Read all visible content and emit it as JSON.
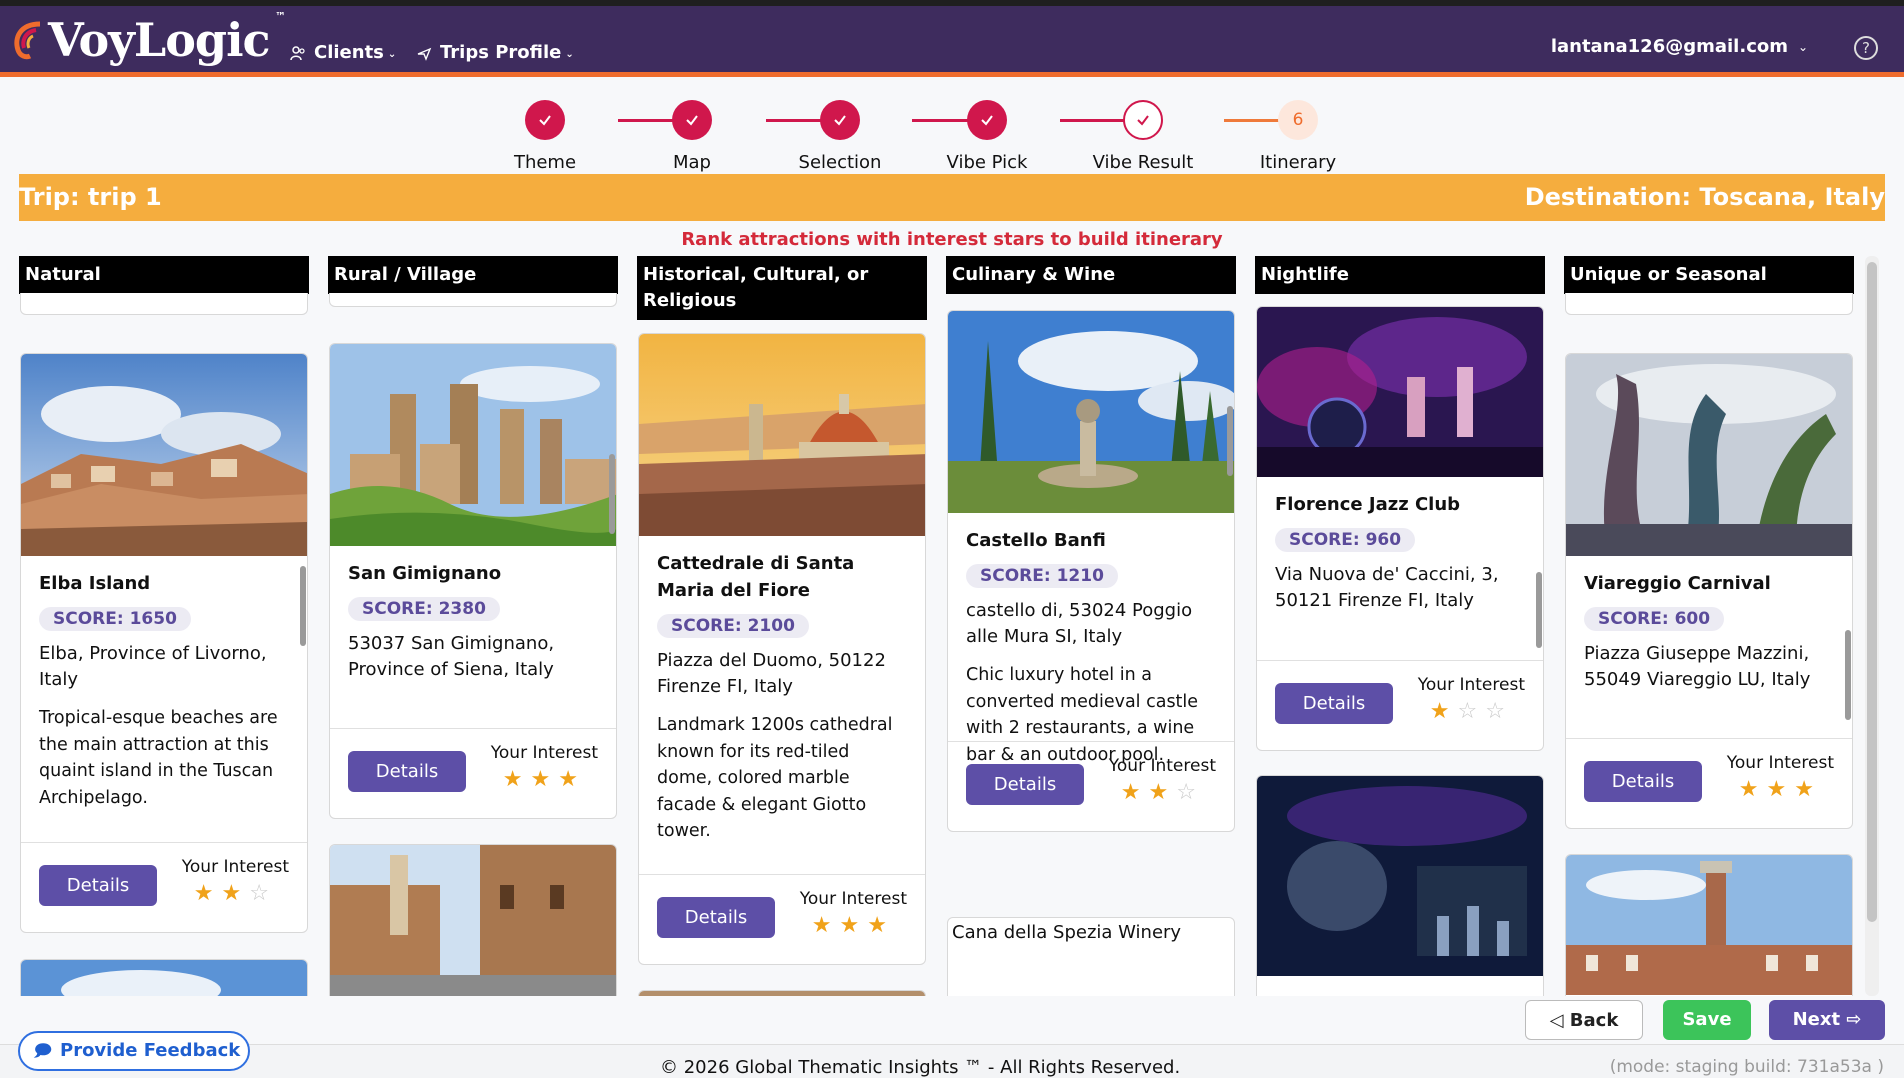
{
  "app": {
    "logo_text": "VoyLogic",
    "logo_tm": "™",
    "nav": [
      {
        "label": "Clients",
        "icon": "users-icon"
      },
      {
        "label": "Trips Profile",
        "icon": "plane-icon"
      }
    ],
    "user_email": "lantana126@gmail.com",
    "help_label": "?"
  },
  "stepper": {
    "steps": [
      {
        "label": "Theme",
        "state": "done"
      },
      {
        "label": "Map",
        "state": "done"
      },
      {
        "label": "Selection",
        "state": "done"
      },
      {
        "label": "Vibe Pick",
        "state": "done"
      },
      {
        "label": "Vibe Result",
        "state": "current"
      },
      {
        "label": "Itinerary",
        "state": "pending",
        "number": "6"
      }
    ]
  },
  "trip": {
    "trip_label": "Trip: trip 1",
    "destination_label": "Destination: Toscana, Italy"
  },
  "hint": "Rank attractions with interest stars to build itinerary",
  "labels": {
    "details": "Details",
    "your_interest": "Your Interest"
  },
  "columns": [
    {
      "title": "Natural",
      "cards": [
        {
          "title": "Elba Island",
          "score": "SCORE: 1650",
          "address": "Elba, Province of Livorno, Italy",
          "description": "Tropical-esque beaches are the main attraction at this quaint island in the Tuscan Archipelago.",
          "stars": 2
        }
      ]
    },
    {
      "title": "Rural / Village",
      "cards": [
        {
          "title": "San Gimignano",
          "score": "SCORE: 2380",
          "address": "53037 San Gimignano, Province of Siena, Italy",
          "description": "",
          "stars": 3
        }
      ]
    },
    {
      "title": "Historical, Cultural, or Religious",
      "cards": [
        {
          "title": "Cattedrale di Santa Maria del Fiore",
          "score": "SCORE: 2100",
          "address": "Piazza del Duomo, 50122 Firenze FI, Italy",
          "description": "Landmark 1200s cathedral known for its red-tiled dome, colored marble facade & elegant Giotto tower.",
          "stars": 3
        }
      ]
    },
    {
      "title": "Culinary & Wine",
      "cards": [
        {
          "title": "Castello Banfi",
          "score": "SCORE: 1210",
          "address": "castello di, 53024 Poggio alle Mura SI, Italy",
          "description": "Chic luxury hotel in a converted medieval castle with 2 restaurants, a wine bar & an outdoor pool.",
          "stars": 2
        }
      ],
      "next_card_title": "Cana della Spezia Winery"
    },
    {
      "title": "Nightlife",
      "cards": [
        {
          "title": "Florence Jazz Club",
          "score": "SCORE: 960",
          "address": "Via Nuova de' Caccini, 3, 50121 Firenze FI, Italy",
          "description": "",
          "stars": 1
        }
      ]
    },
    {
      "title": "Unique or Seasonal",
      "cards": [
        {
          "title": "Viareggio Carnival",
          "score": "SCORE: 600",
          "address": "Piazza Giuseppe Mazzini, 55049 Viareggio LU, Italy",
          "description": "",
          "stars": 3
        }
      ]
    }
  ],
  "actions": {
    "back": "Back",
    "save": "Save",
    "next": "Next"
  },
  "feedback": "Provide Feedback",
  "footer": {
    "copyright": "© 2026 Global Thematic Insights ™ - All Rights Reserved.",
    "mode": "(mode: staging    build: 731a53a )"
  },
  "colors": {
    "header": "#3e2c5e",
    "accent_orange": "#ef6c2d",
    "step_red": "#d0174c",
    "trip_bar": "#f5ad3e",
    "button_purple": "#5d4fa7",
    "save_green": "#3cc45a",
    "star": "#f0a21a"
  }
}
